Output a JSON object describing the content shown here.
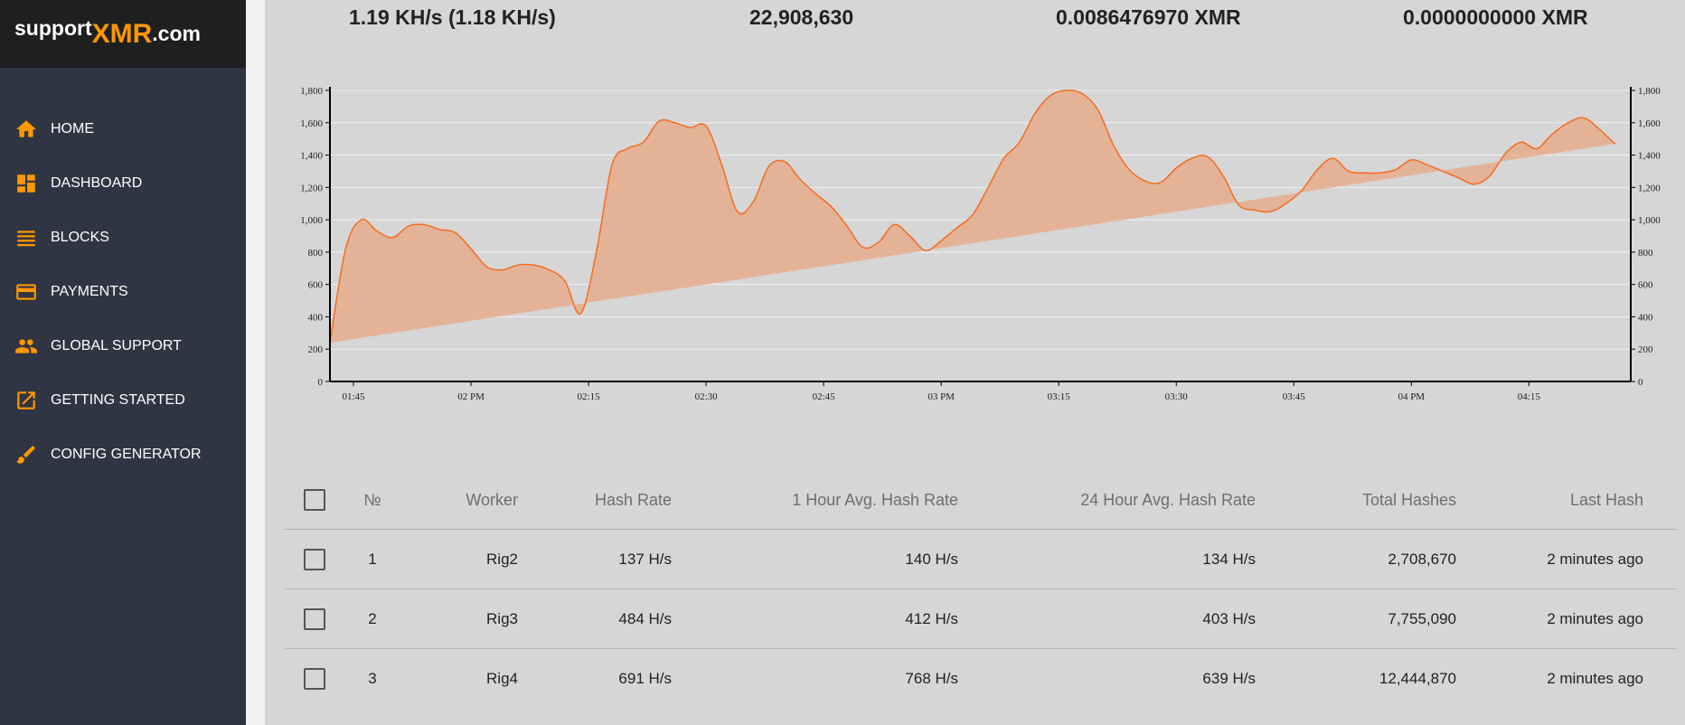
{
  "logo": {
    "part1": "support",
    "part2": "XMR",
    "part3": ".com"
  },
  "colors": {
    "accent": "#ff9800",
    "sidebar": "#2f3542",
    "chart_line": "#f36c21",
    "chart_fill": "#e6ad8c"
  },
  "nav": [
    {
      "label": "HOME",
      "icon": "home-icon"
    },
    {
      "label": "DASHBOARD",
      "icon": "dashboard-icon"
    },
    {
      "label": "BLOCKS",
      "icon": "list-icon"
    },
    {
      "label": "PAYMENTS",
      "icon": "credit-card-icon"
    },
    {
      "label": "GLOBAL SUPPORT",
      "icon": "group-icon"
    },
    {
      "label": "GETTING STARTED",
      "icon": "open-external-icon"
    },
    {
      "label": "CONFIG GENERATOR",
      "icon": "brush-icon"
    }
  ],
  "stats": {
    "hashrate": "1.19 KH/s (1.18 KH/s)",
    "total_hashes": "22,908,630",
    "balance": "0.0086476970 XMR",
    "paid": "0.0000000000 XMR"
  },
  "chart_data": {
    "type": "area",
    "xlabel": "",
    "ylabel": "",
    "ylim": [
      0,
      1800
    ],
    "yticks": [
      "0",
      "200",
      "400",
      "600",
      "800",
      "1,000",
      "1,200",
      "1,400",
      "1,600",
      "1,800"
    ],
    "xticks": [
      "01:45",
      "02 PM",
      "02:15",
      "02:30",
      "02:45",
      "03 PM",
      "03:15",
      "03:30",
      "03:45",
      "04 PM",
      "04:15"
    ],
    "grid": true,
    "legend": "none",
    "x": [
      "01:42",
      "01:44",
      "01:46",
      "01:48",
      "01:50",
      "01:52",
      "01:54",
      "01:56",
      "01:58",
      "02:00",
      "02:02",
      "02:04",
      "02:06",
      "02:08",
      "02:10",
      "02:12",
      "02:14",
      "02:16",
      "02:18",
      "02:20",
      "02:22",
      "02:24",
      "02:26",
      "02:28",
      "02:30",
      "02:32",
      "02:34",
      "02:36",
      "02:38",
      "02:40",
      "02:42",
      "02:44",
      "02:46",
      "02:48",
      "02:50",
      "02:52",
      "02:54",
      "02:56",
      "02:58",
      "03:00",
      "03:02",
      "03:04",
      "03:06",
      "03:08",
      "03:10",
      "03:12",
      "03:14",
      "03:16",
      "03:18",
      "03:20",
      "03:22",
      "03:24",
      "03:26",
      "03:28",
      "03:30",
      "03:32",
      "03:34",
      "03:36",
      "03:38",
      "03:40",
      "03:42",
      "03:44",
      "03:46",
      "03:48",
      "03:50",
      "03:52",
      "03:54",
      "03:56",
      "03:58",
      "04:00",
      "04:02",
      "04:04",
      "04:06",
      "04:08",
      "04:10",
      "04:12",
      "04:14",
      "04:16",
      "04:18",
      "04:20",
      "04:22",
      "04:24",
      "04:26",
      "04:28"
    ],
    "series": [
      {
        "values": [
          240,
          820,
          1000,
          930,
          890,
          960,
          970,
          940,
          920,
          820,
          710,
          690,
          720,
          720,
          690,
          620,
          420,
          800,
          1340,
          1440,
          1480,
          1610,
          1600,
          1570,
          1580,
          1340,
          1050,
          1110,
          1330,
          1360,
          1250,
          1160,
          1080,
          960,
          830,
          860,
          970,
          900,
          810,
          870,
          950,
          1030,
          1200,
          1380,
          1480,
          1660,
          1770,
          1800,
          1780,
          1680,
          1460,
          1310,
          1240,
          1230,
          1320,
          1380,
          1390,
          1270,
          1090,
          1060,
          1050,
          1100,
          1180,
          1310,
          1380,
          1300,
          1290,
          1290,
          1310,
          1370,
          1340,
          1300,
          1260,
          1220,
          1270,
          1410,
          1480,
          1440,
          1530,
          1600,
          1630,
          1560,
          1470,
          1410,
          1320
        ]
      }
    ]
  },
  "table": {
    "headers": [
      "№",
      "Worker",
      "Hash Rate",
      "1 Hour Avg. Hash Rate",
      "24 Hour Avg. Hash Rate",
      "Total Hashes",
      "Last Hash"
    ],
    "rows": [
      [
        "1",
        "Rig2",
        "137 H/s",
        "140 H/s",
        "134 H/s",
        "2,708,670",
        "2 minutes ago"
      ],
      [
        "2",
        "Rig3",
        "484 H/s",
        "412 H/s",
        "403 H/s",
        "7,755,090",
        "2 minutes ago"
      ],
      [
        "3",
        "Rig4",
        "691 H/s",
        "768 H/s",
        "639 H/s",
        "12,444,870",
        "2 minutes ago"
      ]
    ]
  }
}
